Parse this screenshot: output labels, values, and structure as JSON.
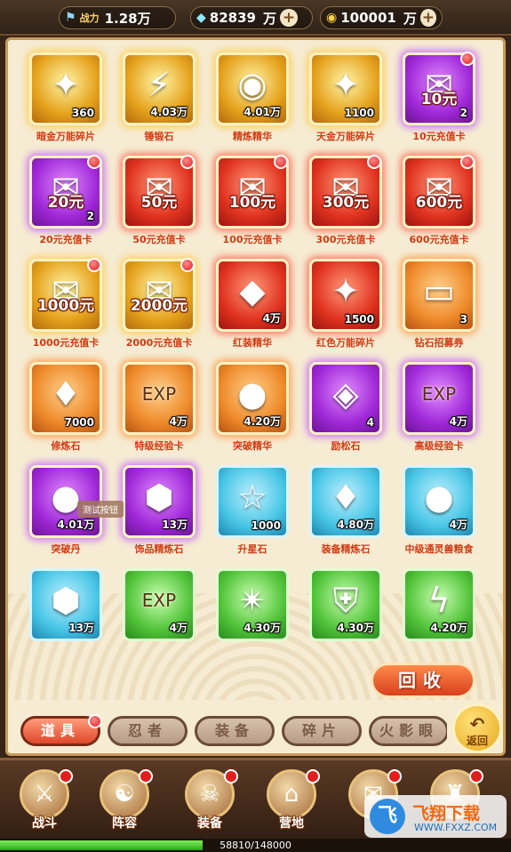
{
  "top": {
    "power_label": "战力",
    "power_value": "1.28万",
    "gems_value": "82839",
    "gems_unit": "万",
    "coins_value": "100001",
    "coins_unit": "万"
  },
  "items": [
    {
      "name": "暗金万能碎片",
      "count": "360",
      "quality": "gold",
      "icon": "puzzle-icon",
      "glyph": "✦",
      "dot": false,
      "price": ""
    },
    {
      "name": "锤锻石",
      "count": "4.03万",
      "quality": "gold",
      "icon": "hammer-stone-icon",
      "glyph": "⚡",
      "dot": false,
      "price": ""
    },
    {
      "name": "精炼精华",
      "count": "4.01万",
      "quality": "gold",
      "icon": "essence-icon",
      "glyph": "◉",
      "dot": false,
      "price": ""
    },
    {
      "name": "天金万能碎片",
      "count": "1100",
      "quality": "gold",
      "icon": "puzzle-icon",
      "glyph": "✦",
      "dot": false,
      "price": ""
    },
    {
      "name": "10元充值卡",
      "count": "2",
      "quality": "purple",
      "icon": "red-envelope-icon",
      "glyph": "✉",
      "dot": true,
      "price": "10元"
    },
    {
      "name": "20元充值卡",
      "count": "2",
      "quality": "purple",
      "icon": "red-envelope-icon",
      "glyph": "✉",
      "dot": true,
      "price": "20元"
    },
    {
      "name": "50元充值卡",
      "count": "",
      "quality": "red",
      "icon": "red-envelope-icon",
      "glyph": "✉",
      "dot": true,
      "price": "50元"
    },
    {
      "name": "100元充值卡",
      "count": "",
      "quality": "red",
      "icon": "red-envelope-icon",
      "glyph": "✉",
      "dot": true,
      "price": "100元"
    },
    {
      "name": "300元充值卡",
      "count": "",
      "quality": "red",
      "icon": "red-envelope-icon",
      "glyph": "✉",
      "dot": true,
      "price": "300元"
    },
    {
      "name": "600元充值卡",
      "count": "",
      "quality": "red",
      "icon": "red-envelope-icon",
      "glyph": "✉",
      "dot": true,
      "price": "600元"
    },
    {
      "name": "1000元充值卡",
      "count": "",
      "quality": "gold",
      "icon": "red-envelope-icon",
      "glyph": "✉",
      "dot": true,
      "price": "1000元"
    },
    {
      "name": "2000元充值卡",
      "count": "",
      "quality": "gold",
      "icon": "red-envelope-icon",
      "glyph": "✉",
      "dot": true,
      "price": "2000元"
    },
    {
      "name": "红装精华",
      "count": "4万",
      "quality": "red",
      "icon": "red-crystal-icon",
      "glyph": "◆",
      "dot": false,
      "price": ""
    },
    {
      "name": "红色万能碎片",
      "count": "1500",
      "quality": "red",
      "icon": "puzzle-icon",
      "glyph": "✦",
      "dot": false,
      "price": ""
    },
    {
      "name": "钻石招募券",
      "count": "3",
      "quality": "orange",
      "icon": "ticket-icon",
      "glyph": "▭",
      "dot": false,
      "price": ""
    },
    {
      "name": "修炼石",
      "count": "7000",
      "quality": "orange",
      "icon": "blue-crystal-icon",
      "glyph": "♦",
      "dot": false,
      "price": ""
    },
    {
      "name": "特级经验卡",
      "count": "4万",
      "quality": "orange",
      "icon": "exp-scroll-icon",
      "glyph": "EXP",
      "dot": false,
      "price": ""
    },
    {
      "name": "突破精华",
      "count": "4.20万",
      "quality": "orange",
      "icon": "swirl-orb-icon",
      "glyph": "●",
      "dot": false,
      "price": ""
    },
    {
      "name": "励松石",
      "count": "4",
      "quality": "purple",
      "icon": "swirl-gem-icon",
      "glyph": "◈",
      "dot": false,
      "price": ""
    },
    {
      "name": "高级经验卡",
      "count": "4万",
      "quality": "purple",
      "icon": "exp-scroll-icon",
      "glyph": "EXP",
      "dot": false,
      "price": ""
    },
    {
      "name": "突破丹",
      "count": "4.01万",
      "quality": "purple",
      "icon": "pill-icon",
      "glyph": "●",
      "dot": false,
      "price": ""
    },
    {
      "name": "饰品精炼石",
      "count": "13万",
      "quality": "purple",
      "icon": "amber-gem-icon",
      "glyph": "⬢",
      "dot": false,
      "price": ""
    },
    {
      "name": "升星石",
      "count": "1000",
      "quality": "blue",
      "icon": "star-orb-icon",
      "glyph": "☆",
      "dot": false,
      "price": ""
    },
    {
      "name": "装备精炼石",
      "count": "4.80万",
      "quality": "blue",
      "icon": "steel-crystal-icon",
      "glyph": "♦",
      "dot": false,
      "price": ""
    },
    {
      "name": "中级通灵兽粮食",
      "count": "4万",
      "quality": "blue",
      "icon": "yellow-orb-icon",
      "glyph": "●",
      "dot": false,
      "price": ""
    },
    {
      "name": "",
      "count": "13万",
      "quality": "blue",
      "icon": "amber-gem-icon",
      "glyph": "⬢",
      "dot": false,
      "price": ""
    },
    {
      "name": "",
      "count": "4万",
      "quality": "green",
      "icon": "exp-scroll-icon",
      "glyph": "EXP",
      "dot": false,
      "price": ""
    },
    {
      "name": "",
      "count": "4.30万",
      "quality": "green",
      "icon": "shuriken-orb-icon",
      "glyph": "✴",
      "dot": false,
      "price": ""
    },
    {
      "name": "",
      "count": "4.30万",
      "quality": "green",
      "icon": "shield-orb-icon",
      "glyph": "⛨",
      "dot": false,
      "price": ""
    },
    {
      "name": "",
      "count": "4.20万",
      "quality": "green",
      "icon": "lightning-orb-icon",
      "glyph": "ϟ",
      "dot": false,
      "price": ""
    }
  ],
  "tooltip": "测试按钮",
  "recycle_label": "回收",
  "tabs": [
    "道具",
    "忍者",
    "装备",
    "碎片",
    "火影眼"
  ],
  "back_label": "返回",
  "nav": [
    {
      "label": "战斗",
      "icon": "battle-icon",
      "glyph": "⚔"
    },
    {
      "label": "阵容",
      "icon": "lineup-icon",
      "glyph": "☯"
    },
    {
      "label": "装备",
      "icon": "equipment-icon",
      "glyph": "☠"
    },
    {
      "label": "营地",
      "icon": "camp-icon",
      "glyph": "⌂"
    },
    {
      "label": "",
      "icon": "scroll-icon",
      "glyph": "✉"
    },
    {
      "label": "",
      "icon": "bell-icon",
      "glyph": "♜"
    }
  ],
  "exp": {
    "text": "58810/148000",
    "current": 58810,
    "max": 148000
  },
  "watermark": {
    "title": "飞翔下载",
    "url": "WWW.FXXZ.COM",
    "logo": "飞"
  }
}
